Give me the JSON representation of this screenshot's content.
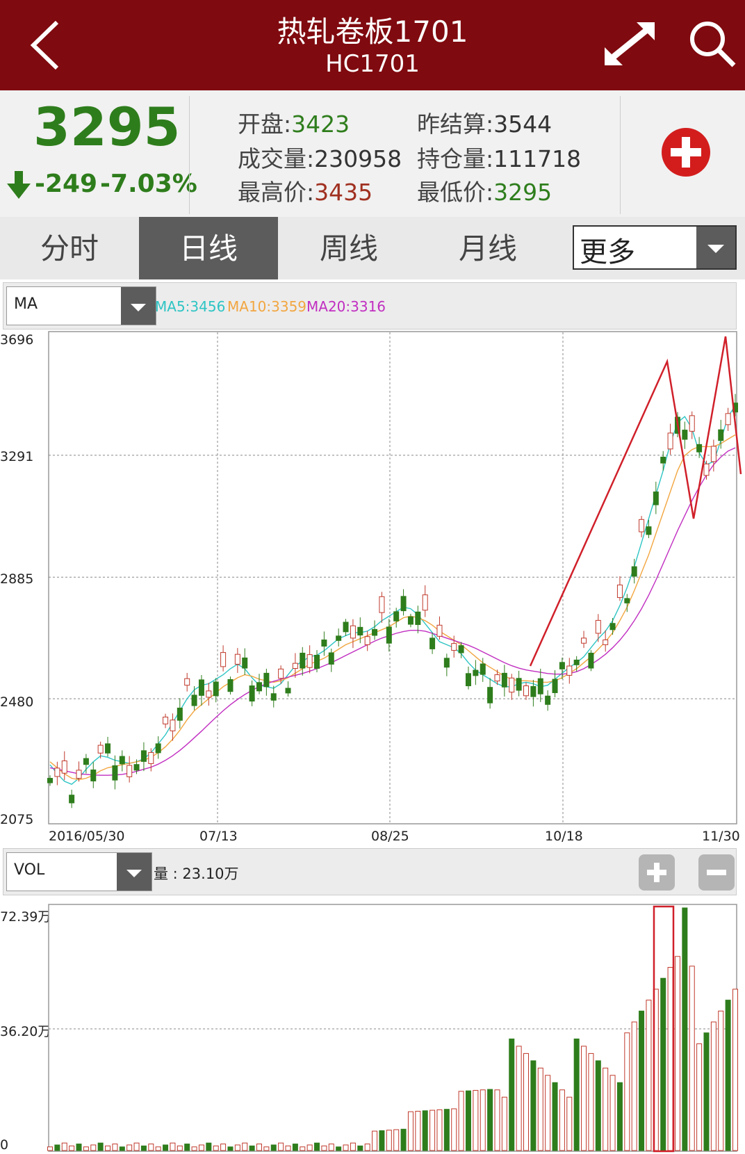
{
  "header": {
    "title": "热轧卷板1701",
    "subtitle": "HC1701"
  },
  "quote": {
    "price": "3295",
    "change": "-249",
    "change_pct": "-7.03%",
    "open_label": "开盘:",
    "open": "3423",
    "prev_settle_label": "昨结算:",
    "prev_settle": "3544",
    "volume_label": "成交量:",
    "volume": "230958",
    "open_interest_label": "持仓量:",
    "open_interest": "111718",
    "high_label": "最高价:",
    "high": "3435",
    "low_label": "最低价:",
    "low": "3295"
  },
  "tabs": [
    {
      "label": "分时",
      "active": false
    },
    {
      "label": "日线",
      "active": true
    },
    {
      "label": "周线",
      "active": false
    },
    {
      "label": "月线",
      "active": false
    }
  ],
  "more_label": "更多",
  "indicator": {
    "select": "MA",
    "ma5": "MA5:3456",
    "ma10": "MA10:3359",
    "ma20": "MA20:3316",
    "ma5_color": "#2ec4c4",
    "ma10_color": "#f2a640",
    "ma20_color": "#c12ec1"
  },
  "volume_panel": {
    "select": "VOL",
    "label": "量 : 23.10万"
  },
  "colors": {
    "up": "#c0392b",
    "down": "#2e7d1c",
    "header": "#7f0a0f"
  },
  "chart_data": [
    {
      "type": "candlestick",
      "y_ticks": [
        "3696",
        "3291",
        "2885",
        "2480",
        "2075"
      ],
      "ylim": [
        2075,
        3696
      ],
      "x_ticks": [
        "2016/05/30",
        "07/13",
        "08/25",
        "10/18",
        "11/30"
      ],
      "grid": true,
      "series": [
        {
          "name": "MA5",
          "values": [
            2260,
            2230,
            2205,
            2195,
            2215,
            2245,
            2270,
            2290,
            2285,
            2275,
            2270,
            2265,
            2270,
            2280,
            2300,
            2330,
            2360,
            2400,
            2440,
            2480,
            2510,
            2525,
            2530,
            2545,
            2560,
            2580,
            2595,
            2580,
            2550,
            2525,
            2520,
            2515,
            2530,
            2560,
            2590,
            2605,
            2620,
            2625,
            2640,
            2660,
            2680,
            2690,
            2700,
            2700,
            2705,
            2720,
            2740,
            2755,
            2770,
            2785,
            2780,
            2760,
            2730,
            2700,
            2670,
            2660,
            2650,
            2630,
            2600,
            2575,
            2560,
            2545,
            2530,
            2520,
            2520,
            2530,
            2535,
            2530,
            2520,
            2525,
            2545,
            2565,
            2585,
            2600,
            2620,
            2650,
            2680,
            2705,
            2740,
            2790,
            2850,
            2920,
            3000,
            3080,
            3160,
            3240,
            3330,
            3400,
            3420,
            3380,
            3300,
            3260,
            3270,
            3340,
            3420,
            3456
          ]
        },
        {
          "name": "MA10",
          "values": [
            2270,
            2250,
            2230,
            2215,
            2210,
            2215,
            2225,
            2240,
            2250,
            2255,
            2260,
            2265,
            2270,
            2275,
            2285,
            2300,
            2320,
            2345,
            2375,
            2410,
            2440,
            2460,
            2480,
            2500,
            2520,
            2535,
            2550,
            2560,
            2555,
            2545,
            2540,
            2535,
            2540,
            2550,
            2565,
            2580,
            2595,
            2605,
            2615,
            2630,
            2645,
            2660,
            2670,
            2680,
            2690,
            2700,
            2710,
            2720,
            2735,
            2750,
            2755,
            2750,
            2740,
            2725,
            2705,
            2690,
            2675,
            2660,
            2640,
            2620,
            2600,
            2585,
            2570,
            2555,
            2545,
            2540,
            2540,
            2538,
            2535,
            2535,
            2540,
            2550,
            2565,
            2580,
            2600,
            2620,
            2645,
            2670,
            2700,
            2740,
            2785,
            2840,
            2900,
            2960,
            3030,
            3100,
            3170,
            3240,
            3290,
            3310,
            3320,
            3320,
            3320,
            3330,
            3345,
            3359
          ]
        },
        {
          "name": "MA20",
          "values": [
            2250,
            2245,
            2240,
            2235,
            2230,
            2228,
            2226,
            2225,
            2225,
            2226,
            2228,
            2232,
            2238,
            2245,
            2252,
            2262,
            2275,
            2290,
            2308,
            2328,
            2350,
            2372,
            2395,
            2418,
            2440,
            2460,
            2478,
            2494,
            2508,
            2520,
            2530,
            2538,
            2545,
            2552,
            2558,
            2564,
            2572,
            2580,
            2590,
            2600,
            2612,
            2624,
            2636,
            2648,
            2660,
            2672,
            2682,
            2690,
            2698,
            2704,
            2708,
            2708,
            2705,
            2698,
            2690,
            2682,
            2674,
            2666,
            2658,
            2648,
            2636,
            2624,
            2612,
            2600,
            2590,
            2582,
            2576,
            2572,
            2568,
            2564,
            2562,
            2562,
            2564,
            2570,
            2580,
            2594,
            2610,
            2628,
            2650,
            2675,
            2705,
            2740,
            2780,
            2825,
            2875,
            2930,
            2985,
            3040,
            3090,
            3140,
            3185,
            3225,
            3260,
            3285,
            3305,
            3316
          ]
        }
      ],
      "annotation": "red zigzag trendline drawn over the recent rally"
    },
    {
      "type": "bar",
      "y_ticks": [
        "72.39万",
        "36.20万",
        "0"
      ],
      "ylim": [
        0,
        72.39
      ],
      "unit": "万",
      "highlight_box": "red rectangle around the tallest volume bar"
    }
  ]
}
